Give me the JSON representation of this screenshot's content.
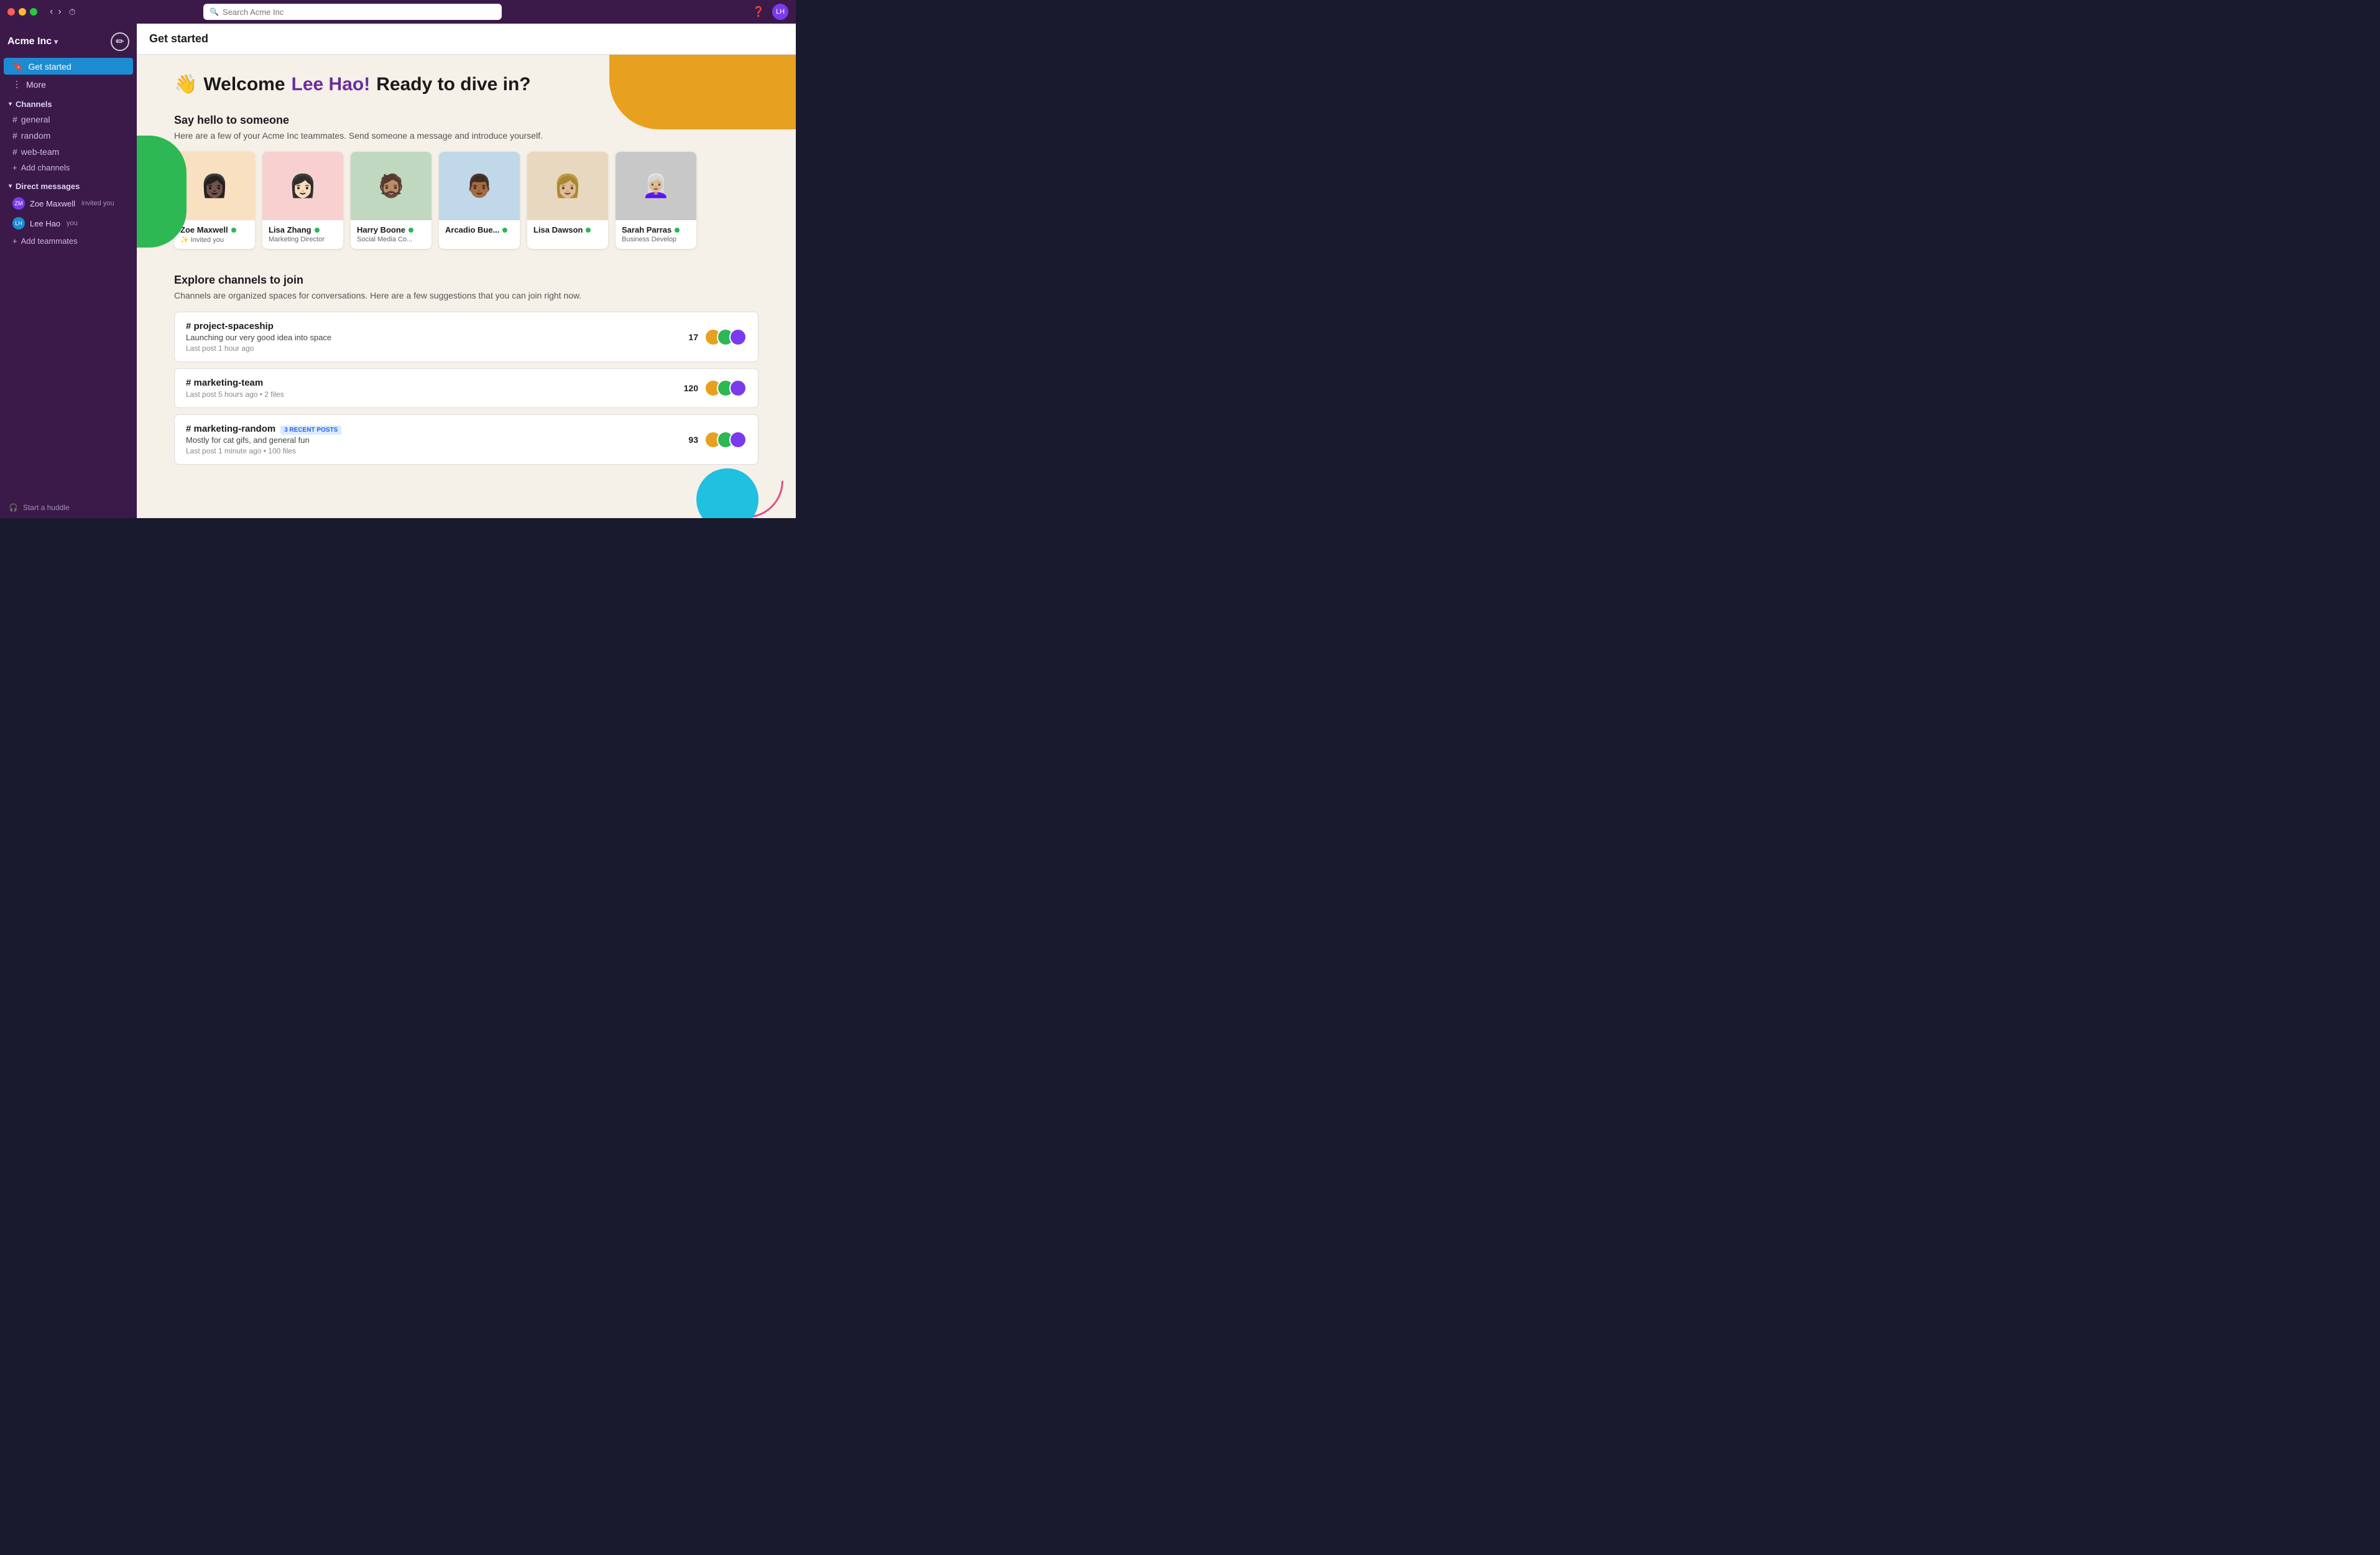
{
  "titlebar": {
    "search_placeholder": "Search Acme Inc"
  },
  "sidebar": {
    "workspace": "Acme Inc",
    "compose_label": "✏",
    "items": [
      {
        "id": "get-started",
        "label": "Get started",
        "active": true
      },
      {
        "id": "more",
        "label": "More",
        "active": false
      }
    ],
    "channels_section": "Channels",
    "channels": [
      {
        "name": "general"
      },
      {
        "name": "random"
      },
      {
        "name": "web-team"
      }
    ],
    "add_channels_label": "Add channels",
    "dm_section": "Direct messages",
    "dms": [
      {
        "name": "Zoe Maxwell",
        "sub": "invited you",
        "initials": "ZM"
      },
      {
        "name": "Lee Hao",
        "sub": "you",
        "initials": "LH"
      }
    ],
    "add_teammates_label": "Add teammates",
    "bottom_label": "Start a huddle"
  },
  "main": {
    "header_title": "Get started",
    "welcome_wave": "👋",
    "welcome_text": "Welcome ",
    "welcome_name": "Lee Hao!",
    "welcome_suffix": " Ready to dive in?",
    "say_hello_title": "Say hello to someone",
    "say_hello_desc": "Here are a few of your Acme Inc teammates. Send someone a message and introduce yourself.",
    "people": [
      {
        "name": "Zoe Maxwell",
        "title": "✨ Invited you",
        "bg": "#f9e0c0"
      },
      {
        "name": "Lisa Zhang",
        "title": "Marketing Director",
        "bg": "#f9d0d0"
      },
      {
        "name": "Harry Boone",
        "title": "Social Media Co...",
        "bg": "#c0d8c0"
      },
      {
        "name": "Arcadio Bue...",
        "title": "",
        "bg": "#c0d8e8"
      },
      {
        "name": "Lisa Dawson",
        "title": "",
        "bg": "#e8d8c0"
      },
      {
        "name": "Sarah Parras",
        "title": "Business Develop",
        "bg": "#c8c8c8"
      }
    ],
    "explore_title": "Explore channels to join",
    "explore_desc": "Channels are organized spaces for conversations. Here are a few suggestions that you can join right now.",
    "channels_explore": [
      {
        "name": "# project-spaceship",
        "desc": "Launching our very good idea into space",
        "meta": "Last post 1 hour ago",
        "count": "17",
        "badge": null
      },
      {
        "name": "# marketing-team",
        "desc": "",
        "meta": "Last post 5 hours ago  •  2 files",
        "count": "120",
        "badge": null
      },
      {
        "name": "# marketing-random",
        "desc": "Mostly for cat gifs, and general fun",
        "meta": "Last post 1 minute ago  •  100 files",
        "count": "93",
        "badge": "3 RECENT POSTS"
      }
    ]
  }
}
